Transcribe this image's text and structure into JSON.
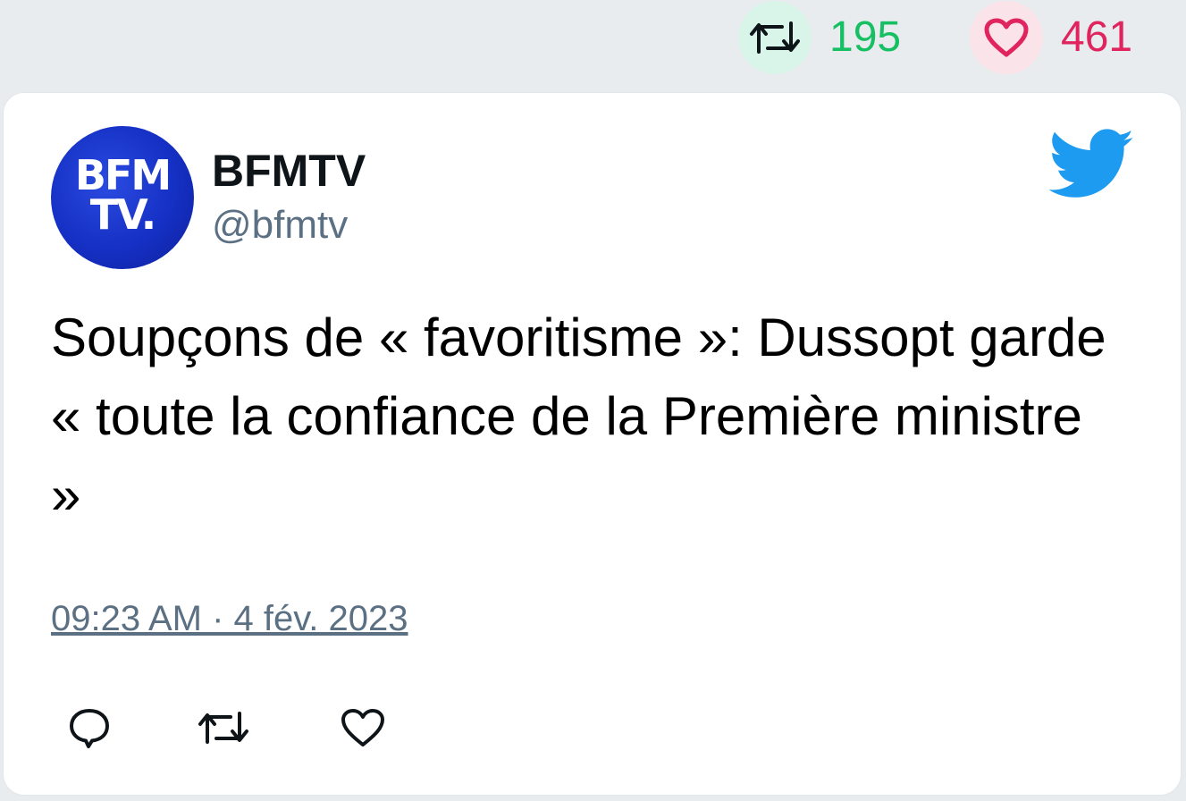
{
  "stats": {
    "retweet_count": "195",
    "like_count": "461",
    "retweet_icon": "retweet-icon",
    "like_icon": "heart-icon",
    "retweet_color": "#17bf63",
    "like_color": "#e0245e"
  },
  "tweet": {
    "author_avatar_line1": "BFM",
    "author_avatar_line2": "TV.",
    "display_name": "BFMTV",
    "handle": "@bfmtv",
    "text": "Soupçons de « favoritisme »: Dussopt garde « toute la confiance de la Première ministre »",
    "timestamp": "09:23 AM · 4 fév. 2023",
    "brand_icon": "twitter-bird-icon",
    "brand_color": "#1d9bf0"
  },
  "actions": {
    "reply_icon": "reply-icon",
    "retweet_icon": "retweet-icon",
    "like_icon": "heart-icon"
  }
}
